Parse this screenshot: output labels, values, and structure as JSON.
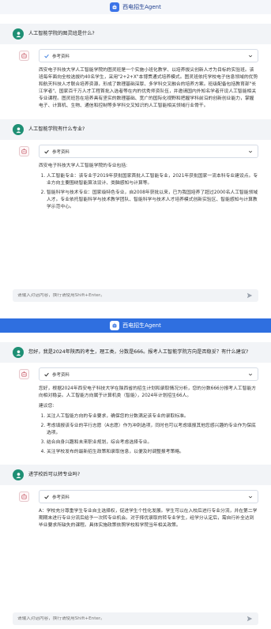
{
  "app": {
    "name": "西电招生Agent"
  },
  "screen_a": {
    "q1": "人工智能学院的图灵班是什么?",
    "a1": {
      "ref_label": "参考资料",
      "text": "西安电子科技大学人工智能学院的图灵班是一个实施小班化教学、以培养拔尖创新人才为目标的实验班。该班每年面向全校选拔约40名学生，采用\"2+2+X\"本博贯通式培养模式。图灵班依托学校电子信息领域的优势和航天科技人才联合培养资源，形成了数理基础深厚、多学科交叉融合的培养方案。班级配备包括教育部\"长江学者\"、国家百千万人才工程首批入选者等在内的优秀师资队伍，并邀请国内外知名学者开设人工智能相关专业课程。图灵班旨在培养具有坚实的数理基础、宽广的国际化视野和把握学科前沿的创新创业能力，掌握电子、计算机、生物、通信和控制等多学科交叉知识的人工智能相关领域行业骨干。"
    },
    "q2": "人工智能学院有什么专业?",
    "a2": {
      "ref_label": "参考资料",
      "intro": "西安电子科技大学人工智能学院的专业包括:",
      "items": [
        "人工智能专业：该专业于2019年获批国家首批人工智能专业，2021年获批国家一流本科专业建设点。专业方向主要围绕智能算法设计、类脑感知与计算等。",
        "智能科学与技术专业：国家级特色专业，自2008年获批以来，已为我国培养了超过2000名人工智能领域人才。专业依托智能科学与技术教学团队、智能科学与技术人才培养模式创新实验区、智能感知与计算教学示范中心。"
      ]
    },
    "input_placeholder": "请输入对话内容，换行请使用Shift+Enter。"
  },
  "screen_b": {
    "q1": "您好，我是2024年陕西的考生，理工类，分数是666。报考人工智能学院方向是否稳妥？有什么建议?",
    "a1": {
      "ref_label": "参考资料",
      "text": "您好，根据2024年西安电子科技大学在陕西省的招生计划和录取情况分析，您的分数666分报考人工智能方向相对稳妥。人工智能方向属于计算机类（智能），2024年计划招生66人。",
      "advice_title": "建议您:",
      "items": [
        "关注人工智能方向的专业要求，确保您的分数满足该专业的录取标准。",
        "考虑填报该专业的平行志愿（A志愿）作为冲刺选项，同时也可以考虑填报其他您感兴趣的专业作为保底选项。",
        "结合自身兴趣和未来职业规划，综合考虑选择专业。",
        "关注学校发布的最新招生政策和录取信息，以便及时调整报考策略。"
      ]
    },
    "q2": "进学校后可以转专业吗?",
    "a2": {
      "ref_label": "参考资料",
      "text": "A：学校充分尊重学生专业自主选择权，促进学生个性化发展。学生可以在入校后进行专业分流，并在第二学期期末进行专业分流后给予一次转专业机会。对于择优录取的转专业学生，经学分认定后，需自行补全达到毕业要求所缺失的课程。具体实施政策依照学校和学院当年相关政策。"
    },
    "input_placeholder": "请输入对话内容，换行请使用Shift+Enter。"
  },
  "colors": {
    "topbar_a": "#f4f6fa",
    "topbar_b": "#2f6fe0",
    "user_avatar": "#1e8f74",
    "user_bubble_bg": "#f2f4f7"
  },
  "icons": {
    "logo": "robot-logo-icon",
    "user": "user-avatar-icon",
    "bot": "agent-avatar-icon",
    "check": "check-icon",
    "chevron": "chevron-down-icon",
    "send": "send-icon"
  }
}
